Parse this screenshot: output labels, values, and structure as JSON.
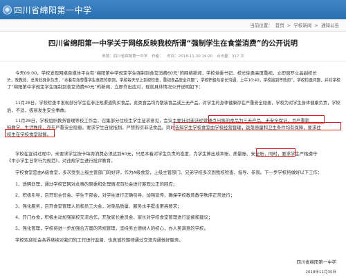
{
  "site": {
    "name": "四川省绵阳第一中学"
  },
  "location": {
    "label": "当前位置：",
    "crumbs": [
      "首页",
      "学校新闻",
      "通知公告"
    ],
    "separator": ">"
  },
  "article": {
    "title": "四川省绵阳第一中学关于网络反映我校所谓“强制学生在食堂消费”的公开说明",
    "meta": {
      "source": "来源：四川省绵阳第一中学",
      "author": "作者：",
      "time": "时间：2018-11-30 19:20",
      "views": "点击量：317 次"
    },
    "lines": {
      "p1a": "今天09:00，学校发现网络自媒体平台有“绵阳第中学规定学生强制到食堂消费60元”的网络新闻，学校党委书记、校长徐勇高度重视，立即调罗立晶副校长",
      "p1b": "头，政教处、总务处具体负责，“本着有效尊重学生意愿的原则，学校每天早上到校检查，重视食品安全问题”，学校积极与家长沟通，上午10:40，学校接到市政府”，学校检查问题，并对学校",
      "p1c": "了“绵阳第中学规定学生强制到食堂消费60元”的新闻，立即作出应对，现就具体情况公开说明如下：",
      "p2": "11月28日，学校检查中发现部分学生在非正规渠道购买食品，此类食品均为散装食品或三无产品，对学生的身体健康存在严重安全隐患，学校为对学生身体健康负责，学校",
      "p2b": "后，不适，极易发生安全事故。",
      "p3a_pre": "11月28日，学校组织教务管理等校工作会，召集部分住校生学生征求意见，会议主要针对",
      "p3a_box": "非法经营摊点出售的食品为三无产品，无安全保证",
      "p3a_post": "，且严重影",
      "p3b_pre": "响教学、生活秩序，存在严重安全隐患。要求学生自觉抵制，严禁购买非法食品。",
      "p3b_box": "同时告知学生学校食堂由学校经营管理，饭菜质量和卫生条件均有保障，要求住",
      "p3c_box": "校生在学校食堂就餐。",
      "p4_pre": "学校在宣讲过程中，未要求学生按卡每周消费必须达到60元，只是本着对学生负责的态度，为学生算出成本账、",
      "p4_box": "质量账、安全账",
      "p4_post": "，同时，要求学生严格遵守",
      "p4b": "《中小学生日常行为规范》，对违规学生进行批评教育。",
      "p5": "学校食堂是由A级食堂，多次受到上级主管部门的好评，作为A级食堂，上级主管部门、兄弟学校多次到我校检查、指导、参观。下一步学校将做好以下工作：",
      "l1": "1、透明处理，通过学校官网对此事的原委和处理情况向社会进行客观公正的回应；",
      "l2": "2、积极引导，召开班主任会、学生干部会，对学生进行正确引导，加强宣传，确保学校教育教学秩序正常进行；",
      "l3": "3、强化服务，召开食堂管理人员和员工大会，对菜品质量、服务水平提出更高要求；",
      "l4": "4、开门办食，积极主动加强家校交流合作，开放家长委员会、家长对学校食堂管理进行监督和建议；",
      "l5": "5、强化管理，学校将进一步加强合方面的常规管理，坚持务立德树人的初心，办人民满意的学校。",
      "p6": "学校欢迎社会各界继续对我们的工作进行监督，也真诚的期待通过交流沟通做好服务。"
    },
    "signature": {
      "org": "四川省绵阳第一中学",
      "date": "2018年11月30日"
    }
  }
}
